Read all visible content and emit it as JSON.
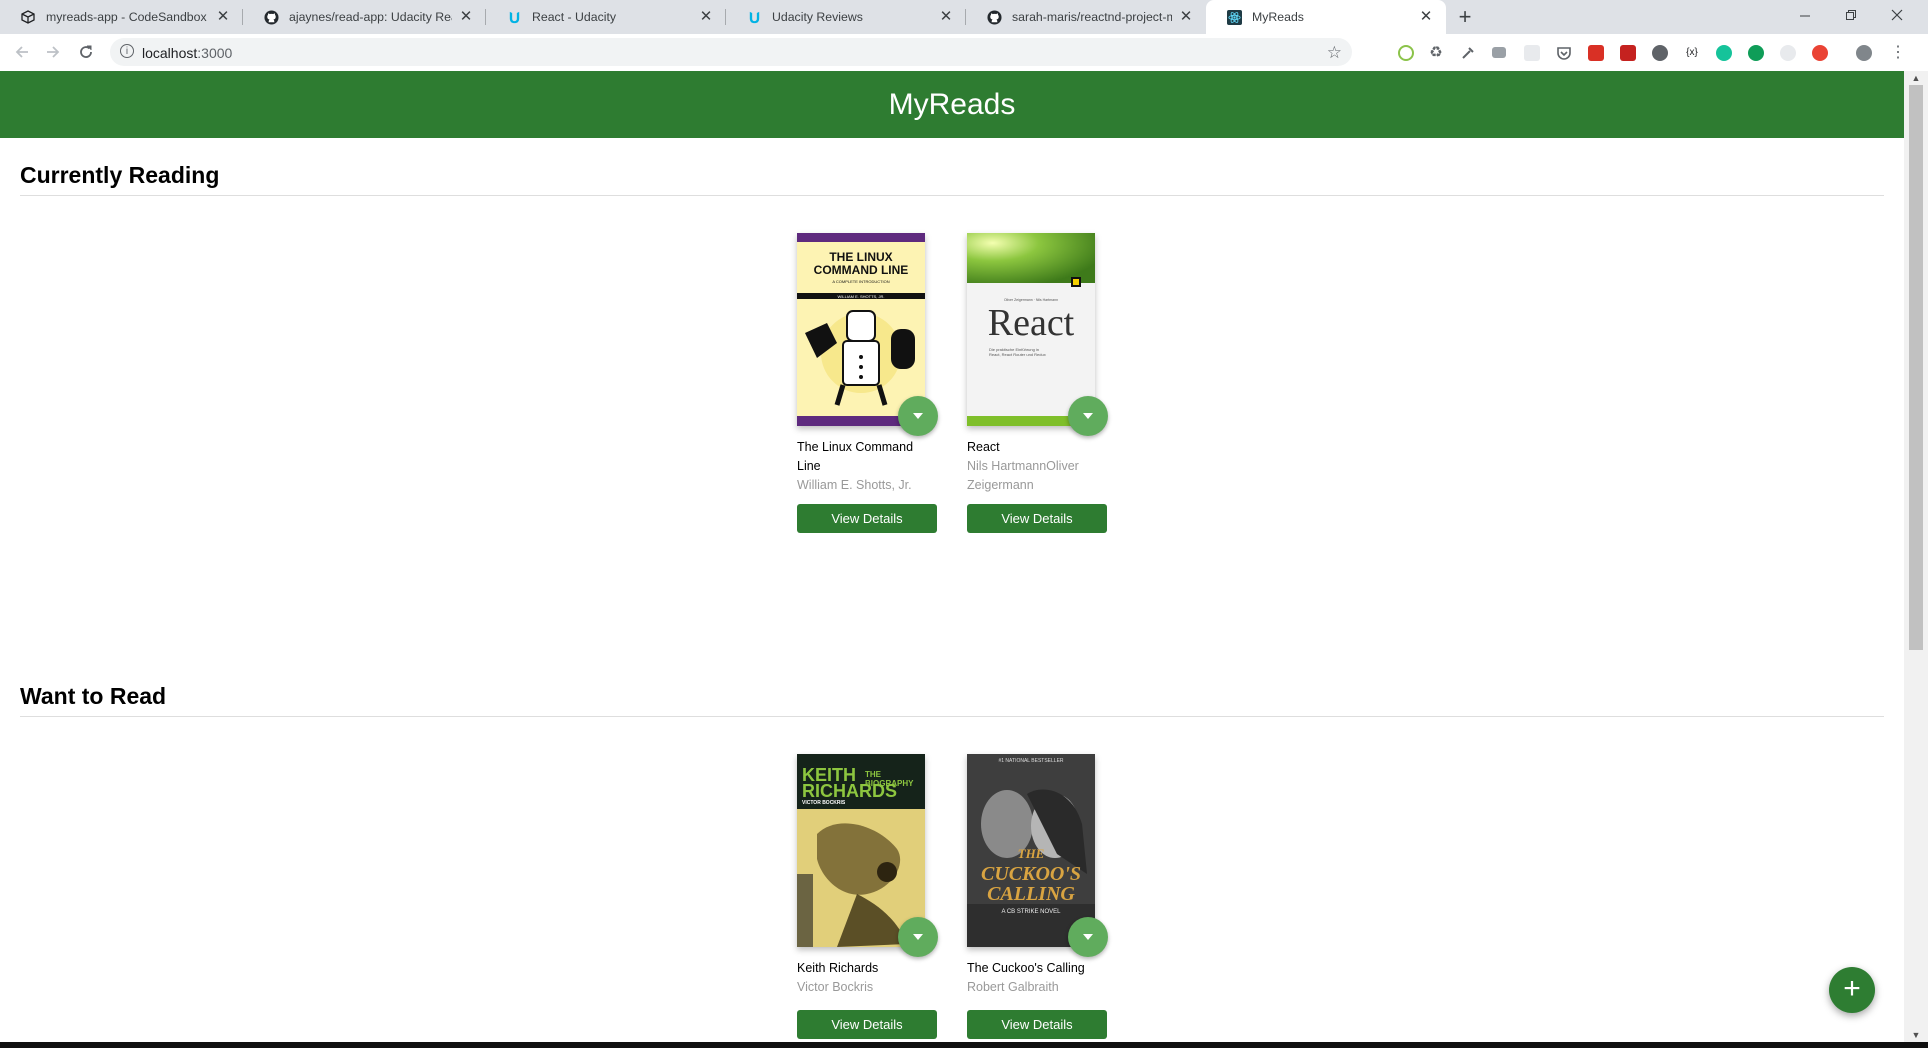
{
  "browser": {
    "tabs": [
      {
        "title": "myreads-app - CodeSandbox",
        "icon": "codesandbox-icon"
      },
      {
        "title": "ajaynes/read-app: Udacity React",
        "icon": "github-icon"
      },
      {
        "title": "React - Udacity",
        "icon": "udacity-icon"
      },
      {
        "title": "Udacity Reviews",
        "icon": "udacity-icon"
      },
      {
        "title": "sarah-maris/reactnd-project-myr",
        "icon": "github-icon"
      },
      {
        "title": "MyReads",
        "icon": "react-icon",
        "active": true
      }
    ],
    "url_host": "localhost",
    "url_port": ":3000",
    "new_tab_glyph": "+",
    "close_glyph": "✕"
  },
  "app": {
    "title": "MyReads",
    "fab_glyph": "+"
  },
  "shelves": [
    {
      "title": "Currently Reading",
      "books": [
        {
          "title": "The Linux Command Line",
          "authors": "William E. Shotts, Jr.",
          "button": "View Details",
          "cover_text": [
            "THE LINUX",
            "COMMAND LINE",
            "A COMPLETE INTRODUCTION",
            "WILLIAM E. SHOTTS, JR."
          ]
        },
        {
          "title": "React",
          "authors": "Nils HartmannOliver Zeigermann",
          "button": "View Details",
          "cover_text": [
            "Oliver Zeigermann · Nils Hartmann",
            "React",
            "Die praktische Einführung in React, React Router und Redux"
          ]
        }
      ]
    },
    {
      "title": "Want to Read",
      "books": [
        {
          "title": "Keith Richards",
          "authors": "Victor Bockris",
          "button": "View Details",
          "cover_text": [
            "KEITH",
            "RICHARDS",
            "THE BIOGRAPHY",
            "VICTOR BOCKRIS"
          ]
        },
        {
          "title": "The Cuckoo's Calling",
          "authors": "Robert Galbraith",
          "button": "View Details",
          "cover_text": [
            "#1 NATIONAL BESTSELLER",
            "THE",
            "CUCKOO'S",
            "CALLING",
            "A CB STRIKE NOVEL"
          ]
        }
      ]
    }
  ],
  "colors": {
    "header": "#2e7c31",
    "changer": "#60ac5d",
    "button": "#2e7c31"
  }
}
